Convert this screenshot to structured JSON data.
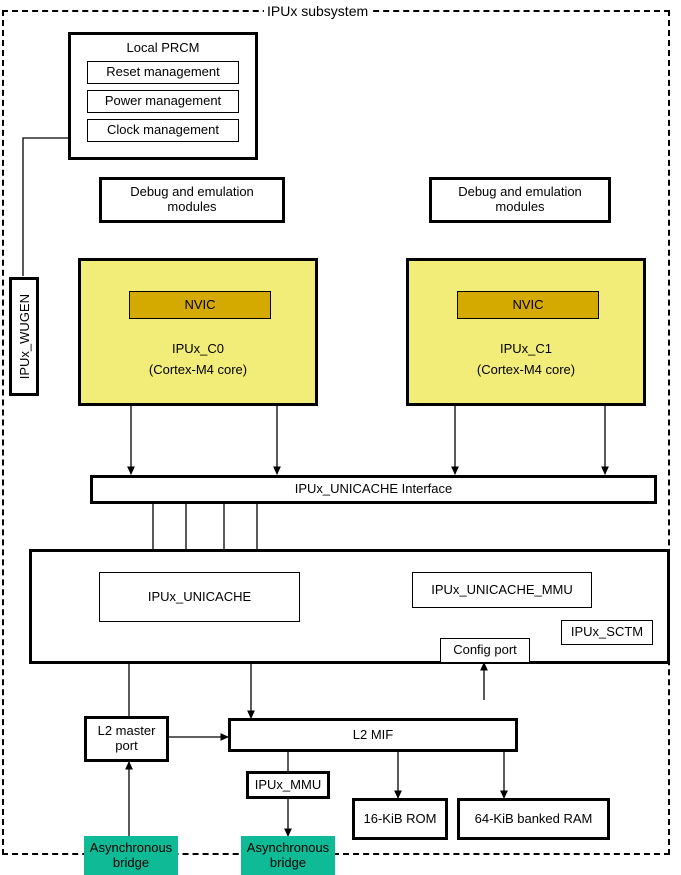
{
  "diagram": {
    "subsystem_label": "IPUx subsystem",
    "colors": {
      "core_fill": "#f2ec79",
      "nvic_fill": "#d4a900",
      "bridge_fill": "#0fba96",
      "line": "#000000",
      "background": "#ffffff"
    }
  },
  "prcm": {
    "title": "Local PRCM",
    "items": [
      {
        "label": "Reset management"
      },
      {
        "label": "Power management"
      },
      {
        "label": "Clock management"
      }
    ]
  },
  "wugen": {
    "label": "IPUx_WUGEN"
  },
  "debug_modules": [
    {
      "label": "Debug and emulation modules"
    },
    {
      "label": "Debug and emulation modules"
    }
  ],
  "cores": [
    {
      "nvic_label": "NVIC",
      "name": "IPUx_C0",
      "subtitle": "(Cortex-M4 core)"
    },
    {
      "nvic_label": "NVIC",
      "name": "IPUx_C1",
      "subtitle": "(Cortex-M4 core)"
    }
  ],
  "unicache_interface": {
    "label": "IPUx_UNICACHE Interface"
  },
  "sctm": {
    "label": "IPUx_SCTM",
    "unicache": {
      "label": "IPUx_UNICACHE"
    },
    "unicache_mmu": {
      "label": "IPUx_UNICACHE_MMU"
    },
    "config_port": {
      "label": "Config port"
    }
  },
  "lower": {
    "l2_master_port": {
      "label": "L2 master port"
    },
    "l2_mif": {
      "label": "L2 MIF"
    },
    "ipux_mmu": {
      "label": "IPUx_MMU"
    },
    "rom": {
      "label": "16-KiB ROM"
    },
    "ram": {
      "label": "64-KiB banked RAM"
    },
    "bridges": [
      {
        "label": "Asynchronous bridge"
      },
      {
        "label": "Asynchronous bridge"
      }
    ]
  }
}
